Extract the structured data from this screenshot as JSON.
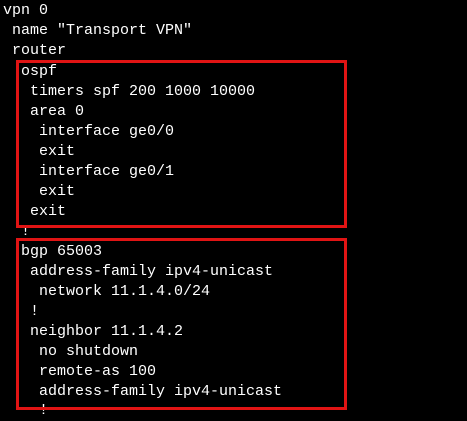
{
  "terminal": {
    "lines": [
      "vpn 0",
      " name \"Transport VPN\"",
      " router",
      "  ospf",
      "   timers spf 200 1000 10000",
      "   area 0",
      "    interface ge0/0",
      "    exit",
      "    interface ge0/1",
      "    exit",
      "   exit",
      "  !",
      "  bgp 65003",
      "   address-family ipv4-unicast",
      "    network 11.1.4.0/24",
      "   !",
      "   neighbor 11.1.4.2",
      "    no shutdown",
      "    remote-as 100",
      "    address-family ipv4-unicast",
      "    !"
    ]
  },
  "highlights": [
    {
      "name": "ospf-highlight-box",
      "color": "#e01414"
    },
    {
      "name": "bgp-highlight-box",
      "color": "#e01414"
    }
  ]
}
